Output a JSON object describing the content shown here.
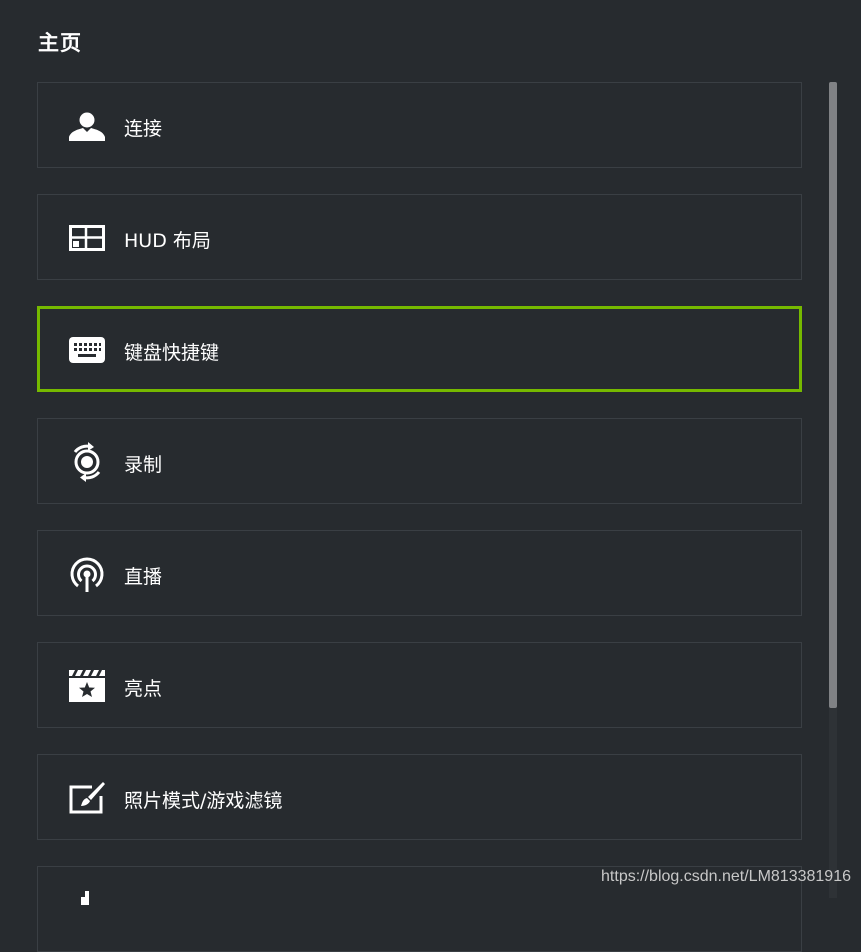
{
  "page": {
    "title": "主页"
  },
  "menu": {
    "items": [
      {
        "label": "连接",
        "icon": "person-icon",
        "selected": false
      },
      {
        "label": "HUD 布局",
        "icon": "hud-layout-icon",
        "selected": false
      },
      {
        "label": "键盘快捷键",
        "icon": "keyboard-icon",
        "selected": true
      },
      {
        "label": "录制",
        "icon": "record-icon",
        "selected": false
      },
      {
        "label": "直播",
        "icon": "broadcast-icon",
        "selected": false
      },
      {
        "label": "亮点",
        "icon": "highlights-icon",
        "selected": false
      },
      {
        "label": "照片模式/游戏滤镜",
        "icon": "photo-mode-icon",
        "selected": false
      },
      {
        "label": "",
        "icon": "performance-icon",
        "selected": false
      }
    ]
  },
  "watermark": "https://blog.csdn.net/LM813381916",
  "colors": {
    "background": "#272b2f",
    "item_border": "#3a3f44",
    "selected_border": "#76b900",
    "scroll_thumb": "#808285"
  }
}
